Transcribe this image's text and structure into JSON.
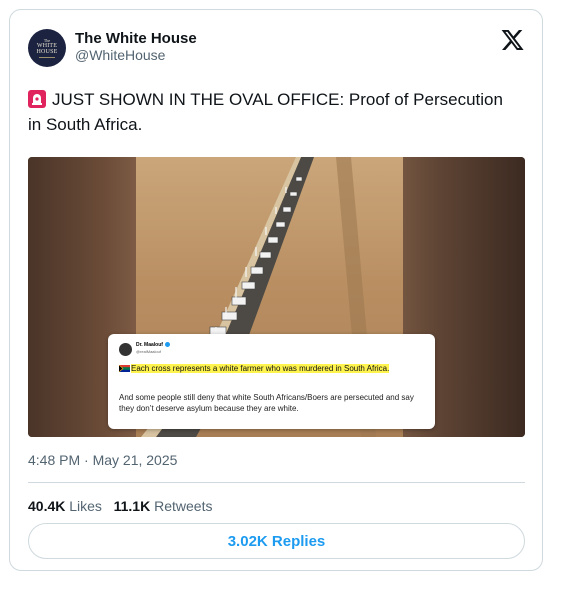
{
  "account": {
    "name": "The White House",
    "handle": "@WhiteHouse",
    "avatar_text": [
      "The",
      "WHITE",
      "HOUSE"
    ]
  },
  "tweet": {
    "emoji_icon": "rotating-light-icon",
    "text": "JUST SHOWN IN THE OVAL OFFICE: Proof of Persecution in South Africa.",
    "timestamp": "4:48 PM · May 21, 2025"
  },
  "media": {
    "embedded_post": {
      "author": "Dr. Maalouf",
      "handle": "@realMaalouf",
      "highlight_text": "Each cross represents a white farmer who was murdered in South Africa.",
      "body_text": "And some people still deny that white South Africans/Boers are persecuted and say they don’t deserve asylum because they are white."
    }
  },
  "stats": {
    "likes_count": "40.4K",
    "likes_label": "Likes",
    "retweets_count": "11.1K",
    "retweets_label": "Retweets"
  },
  "replies_button": "3.02K Replies",
  "colors": {
    "accent": "#1d9bf0",
    "text": "#0f1419",
    "secondary": "#536471",
    "border": "#cfd9de",
    "highlight": "#fff34d"
  }
}
